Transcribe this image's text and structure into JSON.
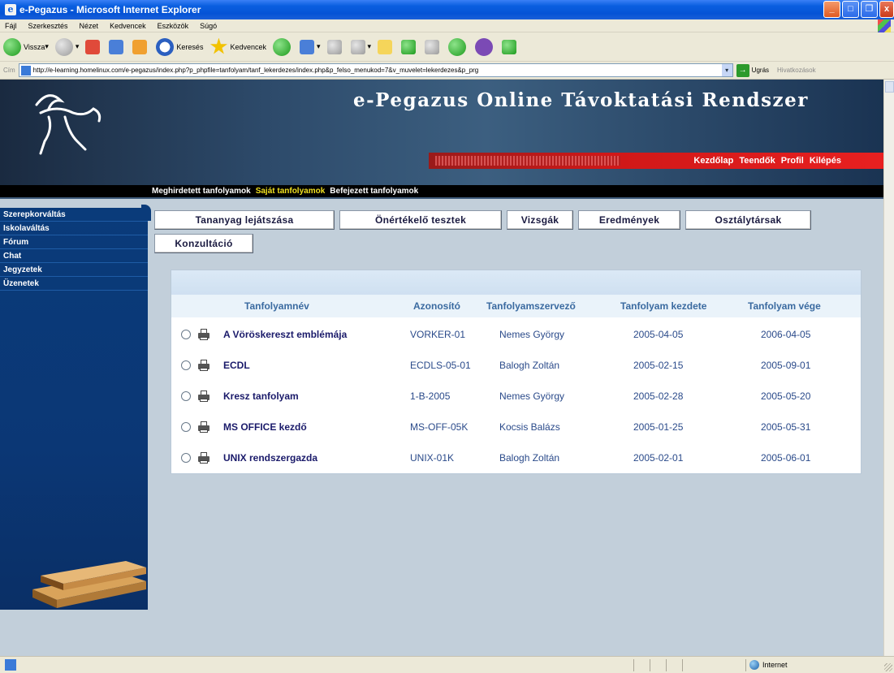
{
  "window": {
    "title": "e-Pegazus - Microsoft Internet Explorer",
    "controls": {
      "minimize": "_",
      "maximize": "□",
      "close": "x"
    }
  },
  "menu": [
    "Fájl",
    "Szerkesztés",
    "Nézet",
    "Kedvencek",
    "Eszközök",
    "Súgó"
  ],
  "toolbar": {
    "back": "Vissza",
    "search": "Keresés",
    "favorites": "Kedvencek"
  },
  "addressbar": {
    "label": "Cím",
    "url": "http://e-learning.homelinux.com/e-pegazus/index.php?p_phpfile=tanfolyam/tanf_lekerdezes/index.php&p_felso_menukod=7&v_muvelet=lekerdezes&p_prg",
    "go_label": "Ugrás",
    "links_label": "Hivatkozások"
  },
  "site": {
    "title": "e-Pegazus Online Távoktatási Rendszer",
    "top_links": [
      "Kezdőlap",
      "Teendők",
      "Profil",
      "Kilépés"
    ],
    "main_nav": [
      {
        "label": "Meghirdetett tanfolyamok",
        "active": false
      },
      {
        "label": "Saját tanfolyamok",
        "active": true
      },
      {
        "label": "Befejezett tanfolyamok",
        "active": false
      }
    ]
  },
  "sidebar": {
    "items": [
      "Szerepkorváltás",
      "Iskolaváltás",
      "Fórum",
      "Chat",
      "Jegyzetek",
      "Üzenetek"
    ]
  },
  "tabs": {
    "row1": [
      "Tananyag lejátszása",
      "Önértékelő tesztek",
      "Vizsgák",
      "Eredmények",
      "Osztálytársak"
    ],
    "row2": [
      "Konzultáció"
    ]
  },
  "table": {
    "headers": [
      "Tanfolyamnév",
      "Azonosító",
      "Tanfolyamszervező",
      "Tanfolyam kezdete",
      "Tanfolyam vége"
    ],
    "rows": [
      {
        "name": "A Vöröskereszt emblémája",
        "id": "VORKER-01",
        "organizer": "Nemes György",
        "start": "2005-04-05",
        "end": "2006-04-05"
      },
      {
        "name": "ECDL",
        "id": "ECDLS-05-01",
        "organizer": "Balogh Zoltán",
        "start": "2005-02-15",
        "end": "2005-09-01"
      },
      {
        "name": "Kresz tanfolyam",
        "id": "1-B-2005",
        "organizer": "Nemes György",
        "start": "2005-02-28",
        "end": "2005-05-20"
      },
      {
        "name": "MS OFFICE kezdő",
        "id": "MS-OFF-05K",
        "organizer": "Kocsis Balázs",
        "start": "2005-01-25",
        "end": "2005-05-31"
      },
      {
        "name": "UNIX rendszergazda",
        "id": "UNIX-01K",
        "organizer": "Balogh Zoltán",
        "start": "2005-02-01",
        "end": "2005-06-01"
      }
    ]
  },
  "statusbar": {
    "zone": "Internet"
  },
  "colors": {
    "titlebar": "#0553d6",
    "sidebar": "#0a3b7a",
    "active_nav": "#f0e020",
    "redbar": "#d01818",
    "page_bg": "#c2cfda"
  }
}
